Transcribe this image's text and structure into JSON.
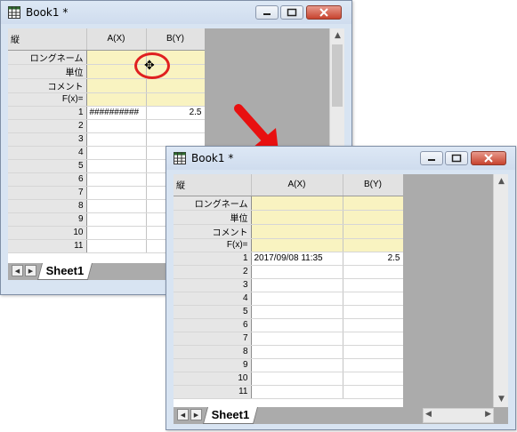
{
  "back_window": {
    "title": "Book1 *",
    "corner": "縦",
    "columns": [
      "A(X)",
      "B(Y)"
    ],
    "property_rows": [
      "ロングネーム",
      "単位",
      "コメント",
      "F(x)="
    ],
    "rows": [
      {
        "n": "1",
        "a": "##########",
        "b": "2.5"
      },
      {
        "n": "2",
        "a": "",
        "b": ""
      },
      {
        "n": "3",
        "a": "",
        "b": ""
      },
      {
        "n": "4",
        "a": "",
        "b": ""
      },
      {
        "n": "5",
        "a": "",
        "b": ""
      },
      {
        "n": "6",
        "a": "",
        "b": ""
      },
      {
        "n": "7",
        "a": "",
        "b": ""
      },
      {
        "n": "8",
        "a": "",
        "b": ""
      },
      {
        "n": "9",
        "a": "",
        "b": ""
      },
      {
        "n": "10",
        "a": "",
        "b": ""
      },
      {
        "n": "11",
        "a": "",
        "b": ""
      }
    ],
    "sheet_tab": "Sheet1"
  },
  "front_window": {
    "title": "Book1 *",
    "corner": "縦",
    "columns": [
      "A(X)",
      "B(Y)"
    ],
    "property_rows": [
      "ロングネーム",
      "単位",
      "コメント",
      "F(x)="
    ],
    "rows": [
      {
        "n": "1",
        "a": "2017/09/08 11:35",
        "b": "2.5"
      },
      {
        "n": "2",
        "a": "",
        "b": ""
      },
      {
        "n": "3",
        "a": "",
        "b": ""
      },
      {
        "n": "4",
        "a": "",
        "b": ""
      },
      {
        "n": "5",
        "a": "",
        "b": ""
      },
      {
        "n": "6",
        "a": "",
        "b": ""
      },
      {
        "n": "7",
        "a": "",
        "b": ""
      },
      {
        "n": "8",
        "a": "",
        "b": ""
      },
      {
        "n": "9",
        "a": "",
        "b": ""
      },
      {
        "n": "10",
        "a": "",
        "b": ""
      },
      {
        "n": "11",
        "a": "",
        "b": ""
      }
    ],
    "sheet_tab": "Sheet1"
  },
  "colors": {
    "highlight": "#e02020",
    "arrow": "#e81010",
    "property_fill": "#f9f3c1"
  },
  "icons": [
    "worksheet-icon",
    "minimize-icon",
    "maximize-icon",
    "close-icon",
    "column-resize-cursor-icon",
    "arrow-icon"
  ]
}
